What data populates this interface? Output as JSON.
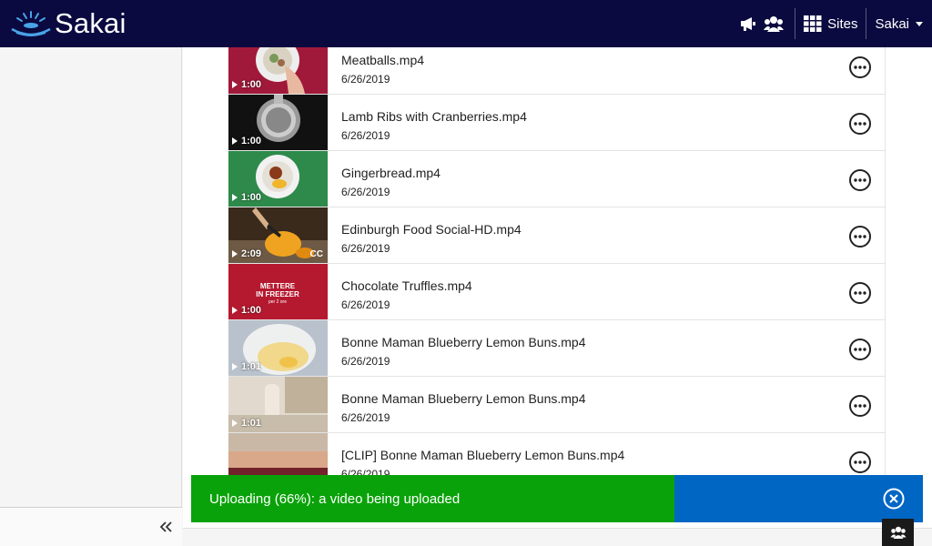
{
  "header": {
    "logo_text": "Sakai",
    "sites_label": "Sites",
    "user_label": "Sakai",
    "icons": [
      "megaphone-icon",
      "users-icon",
      "grid-icon"
    ]
  },
  "media": {
    "items": [
      {
        "title": "Meatballs.mp4",
        "date": "6/26/2019",
        "duration": "1:00",
        "cc": "",
        "thumb_color": "#a1193a"
      },
      {
        "title": "Lamb Ribs with Cranberries.mp4",
        "date": "6/26/2019",
        "duration": "1:00",
        "cc": "",
        "thumb_color": "#111111"
      },
      {
        "title": "Gingerbread.mp4",
        "date": "6/26/2019",
        "duration": "1:00",
        "cc": "",
        "thumb_color": "#2e8a4a"
      },
      {
        "title": "Edinburgh Food Social-HD.mp4",
        "date": "6/26/2019",
        "duration": "2:09",
        "cc": "CC",
        "thumb_color": "#3a2a1c"
      },
      {
        "title": "Chocolate Truffles.mp4",
        "date": "6/26/2019",
        "duration": "1:00",
        "cc": "",
        "thumb_color": "#b5192f",
        "thumb_text": [
          "METTERE",
          "IN FREEZER",
          "per 2 ore"
        ]
      },
      {
        "title": "Bonne Maman Blueberry Lemon Buns.mp4",
        "date": "6/26/2019",
        "duration": "1:01",
        "cc": "",
        "thumb_color": "#b9c2cc"
      },
      {
        "title": "Bonne Maman Blueberry Lemon Buns.mp4",
        "date": "6/26/2019",
        "duration": "1:01",
        "cc": "",
        "thumb_color": "#d8cfc4"
      },
      {
        "title": "[CLIP] Bonne Maman Blueberry Lemon Buns.mp4",
        "date": "6/26/2019",
        "duration": "",
        "cc": "",
        "thumb_color": "#c9b8a6"
      }
    ]
  },
  "upload": {
    "message": "Uploading (66%): a video being uploaded",
    "progress": 0.66,
    "progress_color": "#0aa20a",
    "rest_color": "#0066c4"
  },
  "colors": {
    "header_bg": "#0a0a40",
    "accent": "#0066c4"
  }
}
